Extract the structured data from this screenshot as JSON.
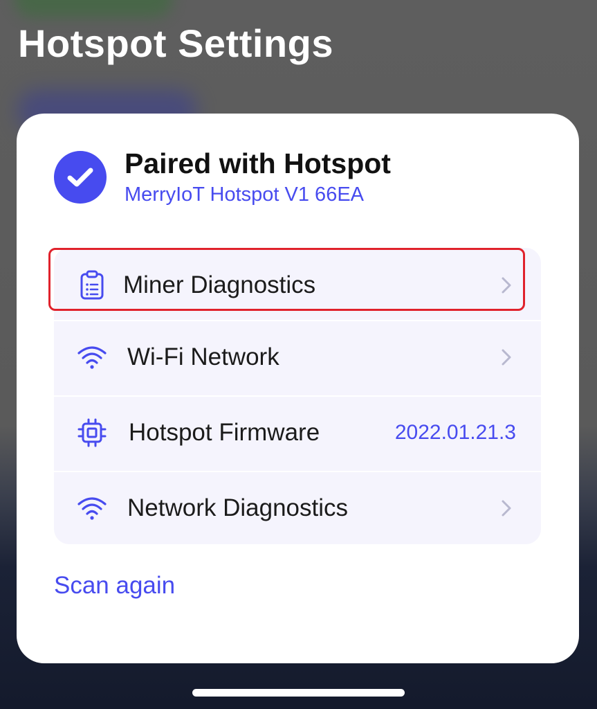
{
  "screen": {
    "title": "Hotspot Settings"
  },
  "paired": {
    "title": "Paired with Hotspot",
    "device_name": "MerryIoT Hotspot V1 66EA",
    "status_icon": "check-circle-icon"
  },
  "menu": {
    "items": [
      {
        "label": "Miner Diagnostics",
        "icon": "clipboard-list-icon",
        "trailing": "chevron-right-icon",
        "highlighted": true
      },
      {
        "label": "Wi-Fi Network",
        "icon": "wifi-icon",
        "trailing": "chevron-right-icon"
      },
      {
        "label": "Hotspot Firmware",
        "icon": "chip-icon",
        "value": "2022.01.21.3"
      },
      {
        "label": "Network Diagnostics",
        "icon": "wifi-icon",
        "trailing": "chevron-right-icon"
      }
    ]
  },
  "actions": {
    "scan_again": "Scan again"
  },
  "colors": {
    "accent": "#474bef",
    "highlight_border": "#e0222c",
    "list_background": "#f5f4fd",
    "title_text": "#ffffff"
  }
}
